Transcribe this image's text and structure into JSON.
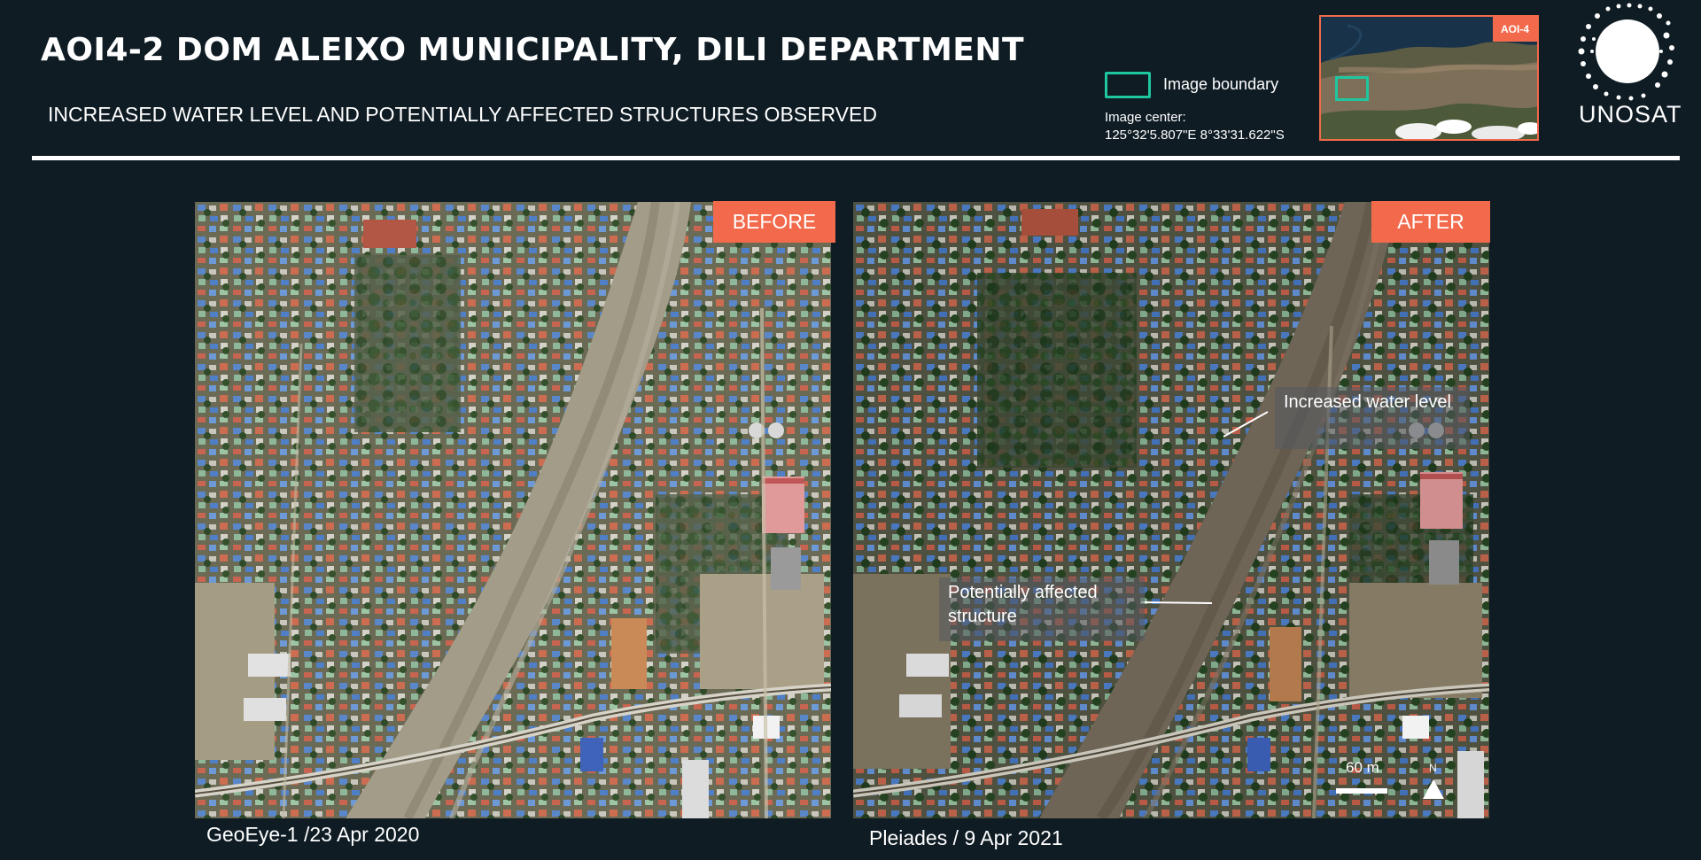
{
  "header": {
    "title": "AOI4-2 DOM ALEIXO MUNICIPALITY, DILI DEPARTMENT",
    "subtitle": "INCREASED WATER LEVEL AND POTENTIALLY AFFECTED STRUCTURES OBSERVED"
  },
  "legend": {
    "boundary_label": "Image boundary",
    "boundary_color": "#1fc7a0",
    "center_label": "Image center:",
    "center_value": "125°32'5.807\"E   8°33'31.622\"S"
  },
  "inset_map": {
    "badge": "AOI-4",
    "badge_color": "#f26a4b"
  },
  "logo": {
    "text": "UNOSAT"
  },
  "panels": {
    "before": {
      "tag": "BEFORE",
      "caption": "GeoEye-1 /23 Apr 2020"
    },
    "after": {
      "tag": "AFTER",
      "caption": "Pleiades / 9 Apr 2021",
      "annotations": {
        "water": "Increased water level",
        "structure": "Potentially affected structure"
      },
      "scale_label": "60 m",
      "north_label": "N"
    }
  },
  "colors": {
    "background": "#0f1c24",
    "accent": "#f26a4b",
    "river_before": "#a39c88",
    "river_after": "#6e6556"
  }
}
